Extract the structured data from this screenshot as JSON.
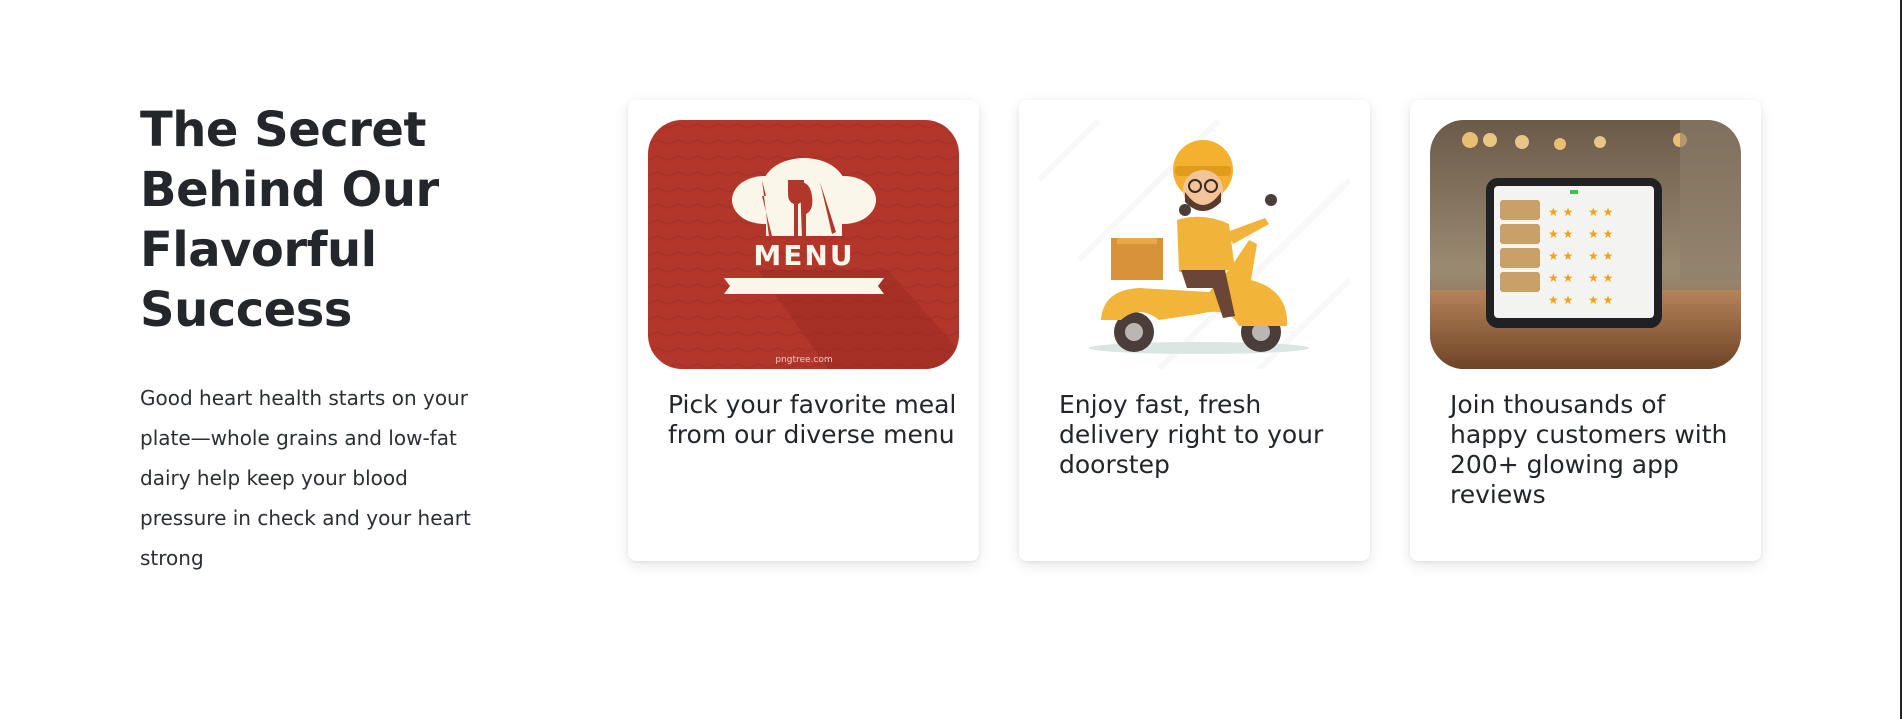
{
  "intro": {
    "title": "The Secret Behind Our Flavorful Success",
    "body": "Good heart health starts on your plate—whole grains and low-fat dairy help keep your blood pressure in check and your heart strong"
  },
  "cards": [
    {
      "caption": "Pick your favorite meal from our diverse menu",
      "image_icon": "chef-hat-menu-icon",
      "menu_label": "MENU",
      "watermark": "pngtree.com"
    },
    {
      "caption": "Enjoy fast, fresh delivery right to your doorstep",
      "image_icon": "delivery-scooter-illustration"
    },
    {
      "caption": "Join thousands of happy customers with 200+ glowing app reviews",
      "image_icon": "tablet-reviews-photo"
    }
  ],
  "colors": {
    "heading": "#23272b",
    "menu_red": "#b0342a",
    "scooter_yellow": "#f2b53a",
    "card_bg": "#ffffff"
  }
}
